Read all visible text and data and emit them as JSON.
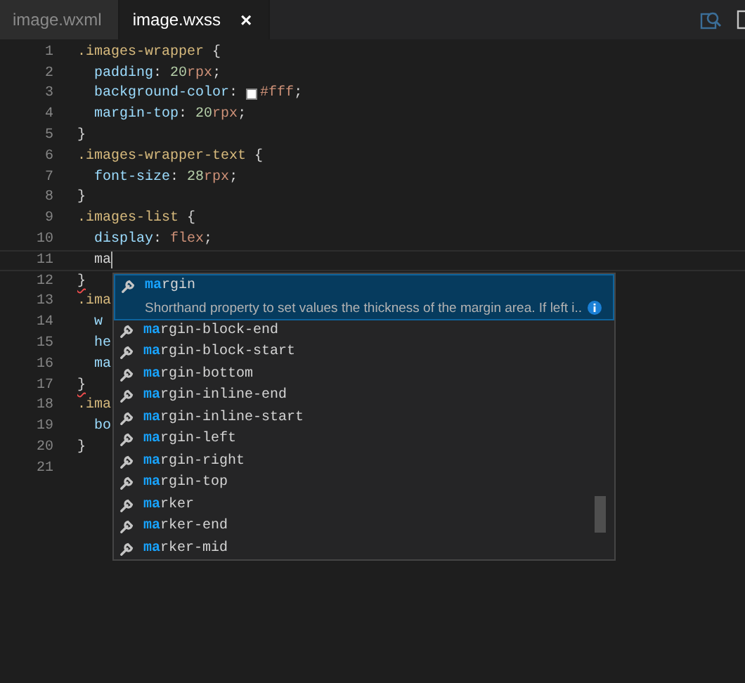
{
  "tabs": [
    {
      "label": "image.wxml",
      "selected": false
    },
    {
      "label": "image.wxss",
      "selected": true,
      "close": "×"
    }
  ],
  "editor": {
    "lines": [
      {
        "number": "1",
        "segments": [
          {
            "kind": "selector",
            "text": ".images-wrapper"
          },
          {
            "kind": "punct",
            "text": " {"
          }
        ]
      },
      {
        "number": "2",
        "segments": [
          {
            "kind": "property",
            "text": "  padding"
          },
          {
            "kind": "punct",
            "text": ": "
          },
          {
            "kind": "number",
            "text": "20"
          },
          {
            "kind": "unit",
            "text": "rpx"
          },
          {
            "kind": "punct",
            "text": ";"
          }
        ]
      },
      {
        "number": "3",
        "segments": [
          {
            "kind": "property",
            "text": "  background-color"
          },
          {
            "kind": "punct",
            "text": ": "
          },
          {
            "kind": "swatch",
            "color": "#ffffff"
          },
          {
            "kind": "value",
            "text": "#fff"
          },
          {
            "kind": "punct",
            "text": ";"
          }
        ]
      },
      {
        "number": "4",
        "segments": [
          {
            "kind": "property",
            "text": "  margin-top"
          },
          {
            "kind": "punct",
            "text": ": "
          },
          {
            "kind": "number",
            "text": "20"
          },
          {
            "kind": "unit",
            "text": "rpx"
          },
          {
            "kind": "punct",
            "text": ";"
          }
        ]
      },
      {
        "number": "5",
        "segments": [
          {
            "kind": "punct",
            "text": "}"
          }
        ]
      },
      {
        "number": "6",
        "segments": [
          {
            "kind": "selector",
            "text": ".images-wrapper-text"
          },
          {
            "kind": "punct",
            "text": " {"
          }
        ]
      },
      {
        "number": "7",
        "segments": [
          {
            "kind": "property",
            "text": "  font-size"
          },
          {
            "kind": "punct",
            "text": ": "
          },
          {
            "kind": "number",
            "text": "28"
          },
          {
            "kind": "unit",
            "text": "rpx"
          },
          {
            "kind": "punct",
            "text": ";"
          }
        ]
      },
      {
        "number": "8",
        "segments": [
          {
            "kind": "punct",
            "text": "}"
          }
        ]
      },
      {
        "number": "9",
        "segments": [
          {
            "kind": "selector",
            "text": ".images-list"
          },
          {
            "kind": "punct",
            "text": " {"
          }
        ]
      },
      {
        "number": "10",
        "segments": [
          {
            "kind": "property",
            "text": "  display"
          },
          {
            "kind": "punct",
            "text": ": "
          },
          {
            "kind": "value",
            "text": "flex"
          },
          {
            "kind": "punct",
            "text": ";"
          }
        ]
      },
      {
        "number": "11",
        "current": true,
        "segments": [
          {
            "kind": "plain",
            "text": "  ma"
          },
          {
            "kind": "cursor"
          }
        ]
      },
      {
        "number": "12",
        "segments": [
          {
            "kind": "error",
            "text": "}"
          }
        ]
      },
      {
        "number": "13",
        "segments": [
          {
            "kind": "selector",
            "text": ".ima"
          }
        ]
      },
      {
        "number": "14",
        "segments": [
          {
            "kind": "property",
            "text": "  w"
          }
        ]
      },
      {
        "number": "15",
        "segments": [
          {
            "kind": "property",
            "text": "  he"
          }
        ]
      },
      {
        "number": "16",
        "segments": [
          {
            "kind": "property",
            "text": "  ma"
          }
        ]
      },
      {
        "number": "17",
        "segments": [
          {
            "kind": "error",
            "text": "}"
          }
        ]
      },
      {
        "number": "18",
        "segments": [
          {
            "kind": "selector",
            "text": ".ima"
          }
        ]
      },
      {
        "number": "19",
        "segments": [
          {
            "kind": "property",
            "text": "  bo"
          }
        ]
      },
      {
        "number": "20",
        "segments": [
          {
            "kind": "punct",
            "text": "}"
          }
        ]
      },
      {
        "number": "21"
      }
    ]
  },
  "suggestions": {
    "items": [
      {
        "match": "ma",
        "rest": "rgin",
        "selected": true,
        "detail": "Shorthand property to set values the thickness of the margin area. If left i.."
      },
      {
        "match": "ma",
        "rest": "rgin-block-end",
        "selected": false
      },
      {
        "match": "ma",
        "rest": "rgin-block-start",
        "selected": false
      },
      {
        "match": "ma",
        "rest": "rgin-bottom",
        "selected": false
      },
      {
        "match": "ma",
        "rest": "rgin-inline-end",
        "selected": false
      },
      {
        "match": "ma",
        "rest": "rgin-inline-start",
        "selected": false
      },
      {
        "match": "ma",
        "rest": "rgin-left",
        "selected": false
      },
      {
        "match": "ma",
        "rest": "rgin-right",
        "selected": false
      },
      {
        "match": "ma",
        "rest": "rgin-top",
        "selected": false
      },
      {
        "match": "ma",
        "rest": "rker",
        "selected": false
      },
      {
        "match": "ma",
        "rest": "rker-end",
        "selected": false
      },
      {
        "match": "ma",
        "rest": "rker-mid",
        "selected": false
      }
    ]
  }
}
